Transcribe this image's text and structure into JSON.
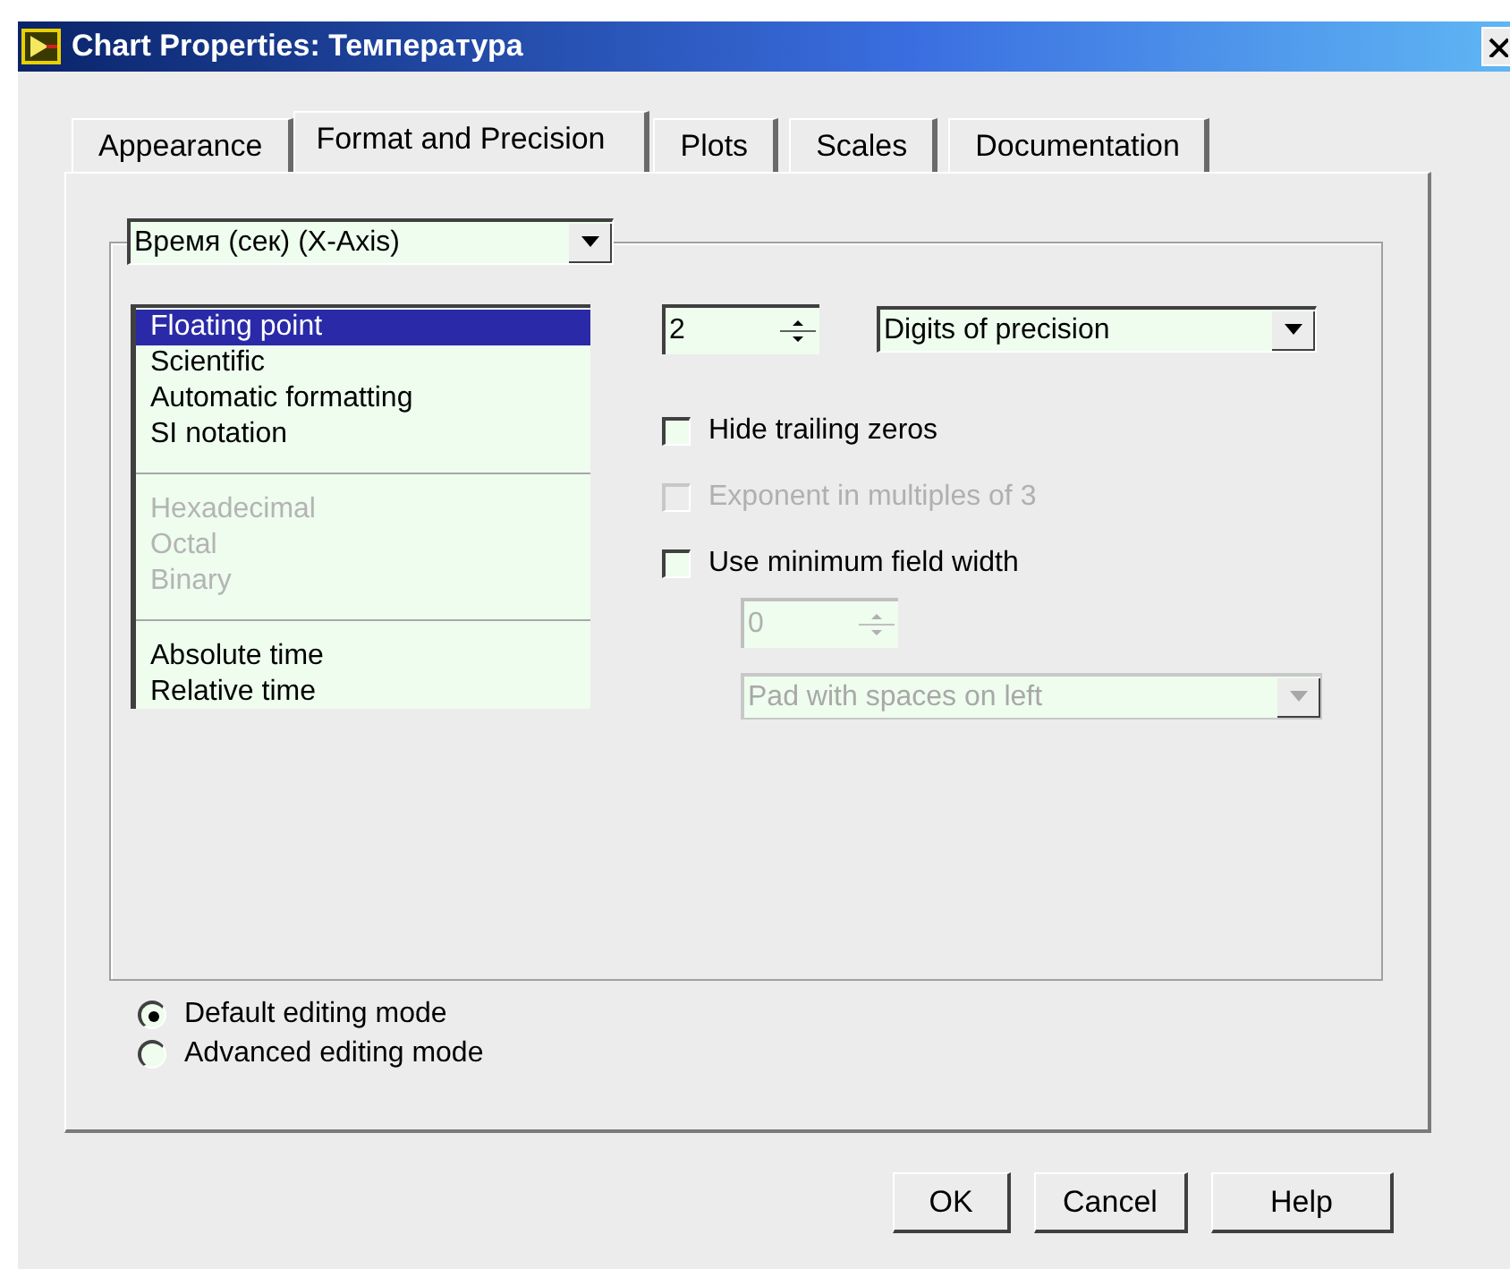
{
  "window": {
    "title": "Chart Properties: Температура"
  },
  "tabs": [
    {
      "label": "Appearance",
      "selected": false
    },
    {
      "label": "Format and Precision",
      "selected": true
    },
    {
      "label": "Plots",
      "selected": false
    },
    {
      "label": "Scales",
      "selected": false
    },
    {
      "label": "Documentation",
      "selected": false
    }
  ],
  "axis_select": {
    "value": "Время (сек) (X-Axis)"
  },
  "format_list": [
    [
      {
        "label": "Floating point",
        "selected": true,
        "disabled": false
      },
      {
        "label": "Scientific",
        "selected": false,
        "disabled": false
      },
      {
        "label": "Automatic formatting",
        "selected": false,
        "disabled": false
      },
      {
        "label": "SI notation",
        "selected": false,
        "disabled": false
      }
    ],
    [
      {
        "label": "Hexadecimal",
        "selected": false,
        "disabled": true
      },
      {
        "label": "Octal",
        "selected": false,
        "disabled": true
      },
      {
        "label": "Binary",
        "selected": false,
        "disabled": true
      }
    ],
    [
      {
        "label": "Absolute time",
        "selected": false,
        "disabled": false
      },
      {
        "label": "Relative time",
        "selected": false,
        "disabled": false
      }
    ]
  ],
  "precision": {
    "value": "2",
    "type": "Digits of precision"
  },
  "options": [
    {
      "label": "Hide trailing zeros",
      "checked": false,
      "disabled": false
    },
    {
      "label": "Exponent in multiples of 3",
      "checked": false,
      "disabled": true
    },
    {
      "label": "Use minimum field width",
      "checked": false,
      "disabled": false
    }
  ],
  "min_width": {
    "value": "0",
    "padding": "Pad with spaces on left",
    "disabled": true
  },
  "editing_modes": [
    {
      "label": "Default editing mode",
      "selected": true
    },
    {
      "label": "Advanced editing mode",
      "selected": false
    }
  ],
  "buttons": [
    "OK",
    "Cancel",
    "Help"
  ]
}
